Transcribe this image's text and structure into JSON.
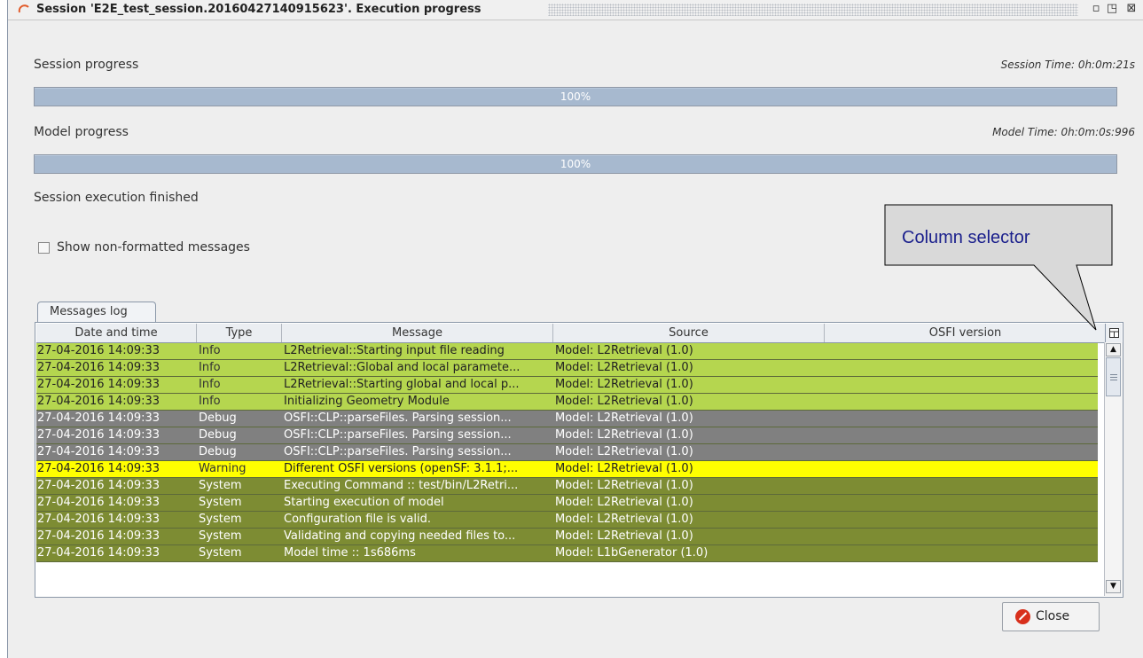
{
  "window": {
    "title": "Session 'E2E_test_session.20160427140915623'. Execution progress",
    "buttons": {
      "minimize": "▫",
      "maximize": "◳",
      "close": "⊠"
    }
  },
  "session": {
    "label": "Session progress",
    "time": "Session Time: 0h:0m:21s",
    "progress": 1.0,
    "progress_text": "100%"
  },
  "model": {
    "label": "Model progress",
    "time": "Model Time: 0h:0m:0s:996",
    "progress": 1.0,
    "progress_text": "100%"
  },
  "status": "Session execution finished",
  "options": {
    "show_non_formatted": "Show non-formatted messages",
    "checked": false
  },
  "tab": {
    "label": "Messages log"
  },
  "table": {
    "columns": [
      "Date and time",
      "Type",
      "Message",
      "Source",
      "OSFI version"
    ],
    "rows": [
      {
        "date": "27-04-2016 14:09:33",
        "type": "Info",
        "message": "L2Retrieval::Starting input file reading",
        "source": "Model: L2Retrieval (1.0)",
        "osfi": "",
        "color": "#b5d64f"
      },
      {
        "date": "27-04-2016 14:09:33",
        "type": "Info",
        "message": "L2Retrieval::Global and local paramete...",
        "source": "Model: L2Retrieval (1.0)",
        "osfi": "",
        "color": "#b5d64f"
      },
      {
        "date": "27-04-2016 14:09:33",
        "type": "Info",
        "message": "L2Retrieval::Starting global and local p...",
        "source": "Model: L2Retrieval (1.0)",
        "osfi": "",
        "color": "#b5d64f"
      },
      {
        "date": "27-04-2016 14:09:33",
        "type": "Info",
        "message": "Initializing Geometry Module",
        "source": "Model: L2Retrieval (1.0)",
        "osfi": "",
        "color": "#b5d64f"
      },
      {
        "date": "27-04-2016 14:09:33",
        "type": "Debug",
        "message": "OSFI::CLP::parseFiles. Parsing session...",
        "source": "Model: L2Retrieval (1.0)",
        "osfi": "",
        "color": "#808080"
      },
      {
        "date": "27-04-2016 14:09:33",
        "type": "Debug",
        "message": "OSFI::CLP::parseFiles. Parsing session...",
        "source": "Model: L2Retrieval (1.0)",
        "osfi": "",
        "color": "#808080"
      },
      {
        "date": "27-04-2016 14:09:33",
        "type": "Debug",
        "message": "OSFI::CLP::parseFiles. Parsing session...",
        "source": "Model: L2Retrieval (1.0)",
        "osfi": "",
        "color": "#808080"
      },
      {
        "date": "27-04-2016 14:09:33",
        "type": "Warning",
        "message": "Different OSFI versions (openSF: 3.1.1;...",
        "source": "Model: L2Retrieval (1.0)",
        "osfi": "",
        "color": "#ffff00"
      },
      {
        "date": "27-04-2016 14:09:33",
        "type": "System",
        "message": "Executing Command :: test/bin/L2Retri...",
        "source": "Model: L2Retrieval (1.0)",
        "osfi": "",
        "color": "#7d8c33"
      },
      {
        "date": "27-04-2016 14:09:33",
        "type": "System",
        "message": "Starting execution of model",
        "source": "Model: L2Retrieval (1.0)",
        "osfi": "",
        "color": "#7d8c33"
      },
      {
        "date": "27-04-2016 14:09:33",
        "type": "System",
        "message": "Configuration file is valid.",
        "source": "Model: L2Retrieval (1.0)",
        "osfi": "",
        "color": "#7d8c33"
      },
      {
        "date": "27-04-2016 14:09:33",
        "type": "System",
        "message": "Validating and copying needed files to...",
        "source": "Model: L2Retrieval (1.0)",
        "osfi": "",
        "color": "#7d8c33"
      },
      {
        "date": "27-04-2016 14:09:33",
        "type": "System",
        "message": "Model time :: 1s686ms",
        "source": "Model: L1bGenerator (1.0)",
        "osfi": "",
        "color": "#7d8c33"
      }
    ]
  },
  "close_button": {
    "label": "Close"
  },
  "annotation": {
    "text": "Column selector"
  }
}
